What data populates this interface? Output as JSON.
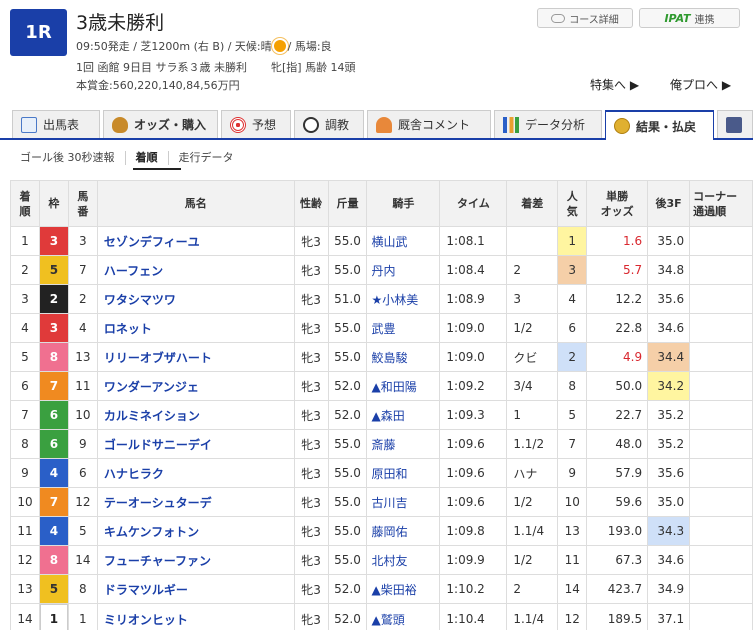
{
  "race": {
    "number": "1R",
    "name": "3歳未勝利",
    "start": "09:50発走 / 芝1200m (右 B) / 天候:晴",
    "track": "/ 馬場:良",
    "meeting": "1回 函館 9日目 サラ系３歳 未勝利",
    "conditions": "牝[指] 馬齢 14頭",
    "prize": "本賞金:560,220,140,84,56万円"
  },
  "header_buttons": {
    "course_detail": "コース詳細",
    "ipat_logo": "IPAT",
    "ipat_label": "連携",
    "tokushu": "特集へ ▶",
    "orepro": "俺プロへ ▶"
  },
  "tabs": [
    {
      "label": "出馬表"
    },
    {
      "label": "オッズ・購入"
    },
    {
      "label": "予想"
    },
    {
      "label": "調教"
    },
    {
      "label": "厩舎コメント"
    },
    {
      "label": "データ分析"
    },
    {
      "label": "結果・払戻"
    },
    {
      "label": ""
    }
  ],
  "subnav": {
    "goal": "ゴール後 30秒速報",
    "order": "着順",
    "running": "走行データ"
  },
  "table": {
    "headers": [
      "着順",
      "枠",
      "馬番",
      "馬名",
      "性齢",
      "斤量",
      "騎手",
      "タイム",
      "着差",
      "人気",
      "単勝オッズ",
      "後3F",
      "コーナー通過順"
    ],
    "header_display": {
      "rank": "着\n順",
      "waku": "枠",
      "umaban": "馬\n番",
      "name": "馬名",
      "sexage": "性齢",
      "weight": "斤量",
      "jockey": "騎手",
      "time": "タイム",
      "margin": "着差",
      "pop": "人\n気",
      "odds": "単勝\nオッズ",
      "last3f": "後3F",
      "corner": "コーナー\n通過順"
    },
    "rows": [
      {
        "rank": "1",
        "waku": "3",
        "umaban": "3",
        "name": "セゾンデフィーユ",
        "sexage": "牝3",
        "weight": "55.0",
        "jockey": "横山武",
        "time": "1:08.1",
        "margin": "",
        "pop": "1",
        "odds": "1.6",
        "last3f": "35.0"
      },
      {
        "rank": "2",
        "waku": "5",
        "umaban": "7",
        "name": "ハーフェン",
        "sexage": "牝3",
        "weight": "55.0",
        "jockey": "丹内",
        "time": "1:08.4",
        "margin": "2",
        "pop": "3",
        "odds": "5.7",
        "last3f": "34.8"
      },
      {
        "rank": "3",
        "waku": "2",
        "umaban": "2",
        "name": "ワタシマツワ",
        "sexage": "牝3",
        "weight": "51.0",
        "jockey": "★小林美",
        "time": "1:08.9",
        "margin": "3",
        "pop": "4",
        "odds": "12.2",
        "last3f": "35.6"
      },
      {
        "rank": "4",
        "waku": "3",
        "umaban": "4",
        "name": "ロネット",
        "sexage": "牝3",
        "weight": "55.0",
        "jockey": "武豊",
        "time": "1:09.0",
        "margin": "1/2",
        "pop": "6",
        "odds": "22.8",
        "last3f": "34.6"
      },
      {
        "rank": "5",
        "waku": "8",
        "umaban": "13",
        "name": "リリーオブザハート",
        "sexage": "牝3",
        "weight": "55.0",
        "jockey": "鮫島駿",
        "time": "1:09.0",
        "margin": "クビ",
        "pop": "2",
        "odds": "4.9",
        "last3f": "34.4"
      },
      {
        "rank": "6",
        "waku": "7",
        "umaban": "11",
        "name": "ワンダーアンジェ",
        "sexage": "牝3",
        "weight": "52.0",
        "jockey": "▲和田陽",
        "time": "1:09.2",
        "margin": "3/4",
        "pop": "8",
        "odds": "50.0",
        "last3f": "34.2"
      },
      {
        "rank": "7",
        "waku": "6",
        "umaban": "10",
        "name": "カルミネイション",
        "sexage": "牝3",
        "weight": "52.0",
        "jockey": "▲森田",
        "time": "1:09.3",
        "margin": "1",
        "pop": "5",
        "odds": "22.7",
        "last3f": "35.2"
      },
      {
        "rank": "8",
        "waku": "6",
        "umaban": "9",
        "name": "ゴールドサニーデイ",
        "sexage": "牝3",
        "weight": "55.0",
        "jockey": "斎藤",
        "time": "1:09.6",
        "margin": "1.1/2",
        "pop": "7",
        "odds": "48.0",
        "last3f": "35.2"
      },
      {
        "rank": "9",
        "waku": "4",
        "umaban": "6",
        "name": "ハナヒラク",
        "sexage": "牝3",
        "weight": "55.0",
        "jockey": "原田和",
        "time": "1:09.6",
        "margin": "ハナ",
        "pop": "9",
        "odds": "57.9",
        "last3f": "35.6"
      },
      {
        "rank": "10",
        "waku": "7",
        "umaban": "12",
        "name": "テーオーシュターデ",
        "sexage": "牝3",
        "weight": "55.0",
        "jockey": "古川吉",
        "time": "1:09.6",
        "margin": "1/2",
        "pop": "10",
        "odds": "59.6",
        "last3f": "35.0"
      },
      {
        "rank": "11",
        "waku": "4",
        "umaban": "5",
        "name": "キムケンフォトン",
        "sexage": "牝3",
        "weight": "55.0",
        "jockey": "藤岡佑",
        "time": "1:09.8",
        "margin": "1.1/4",
        "pop": "13",
        "odds": "193.0",
        "last3f": "34.3"
      },
      {
        "rank": "12",
        "waku": "8",
        "umaban": "14",
        "name": "フューチャーファン",
        "sexage": "牝3",
        "weight": "55.0",
        "jockey": "北村友",
        "time": "1:09.9",
        "margin": "1/2",
        "pop": "11",
        "odds": "67.3",
        "last3f": "34.6"
      },
      {
        "rank": "13",
        "waku": "5",
        "umaban": "8",
        "name": "ドラマツルギー",
        "sexage": "牝3",
        "weight": "52.0",
        "jockey": "▲柴田裕",
        "time": "1:10.2",
        "margin": "2",
        "pop": "14",
        "odds": "423.7",
        "last3f": "34.9"
      },
      {
        "rank": "14",
        "waku": "1",
        "umaban": "1",
        "name": "ミリオンヒット",
        "sexage": "牝3",
        "weight": "52.0",
        "jockey": "▲鷲頭",
        "time": "1:10.4",
        "margin": "1.1/4",
        "pop": "12",
        "odds": "189.5",
        "last3f": "37.1"
      }
    ]
  },
  "colors": {
    "accent": "#1a3fa8",
    "waku": {
      "1": "#ffffff",
      "2": "#222222",
      "3": "#e03a3a",
      "4": "#2a5fc8",
      "5": "#f0c020",
      "6": "#3aa040",
      "7": "#f08a20",
      "8": "#f07090"
    },
    "pop_highlight": {
      "1": "#fff5a0",
      "2": "#cfe0f8",
      "3": "#f5cfa8"
    },
    "odds_red": "#d9282f"
  }
}
